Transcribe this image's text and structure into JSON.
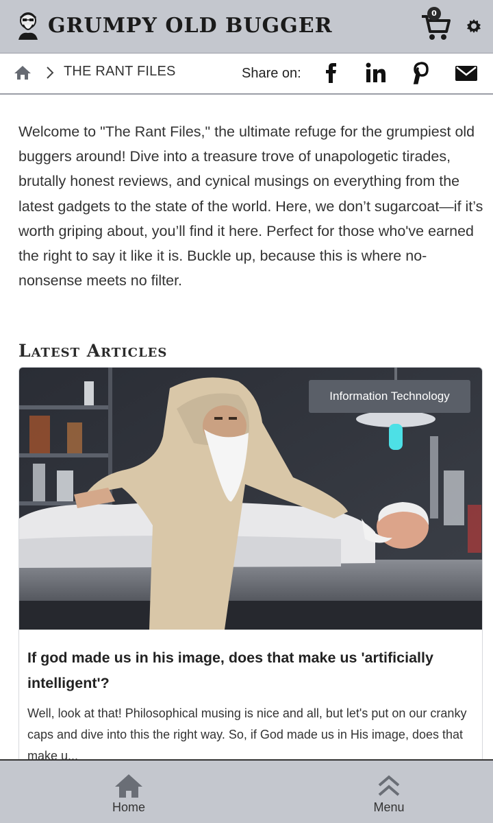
{
  "header": {
    "title": "GRUMPY OLD BUGGER",
    "logo_icon": "grumpy-old-man-face-icon",
    "cart_icon": "shopping-cart-icon",
    "cart_count": "0",
    "settings_icon": "gear-icon"
  },
  "breadcrumb": {
    "home_icon": "home-icon",
    "separator_icon": "chevron-right-icon",
    "current": "THE RANT FILES"
  },
  "share": {
    "label": "Share on:",
    "icons": [
      "facebook-icon",
      "linkedin-icon",
      "pinterest-icon",
      "email-icon"
    ]
  },
  "intro": {
    "text": "Welcome to \"The Rant Files,\" the ultimate refuge for the grumpiest old buggers around! Dive into a treasure trove of unapologetic tirades, brutally honest reviews, and cynical musings on everything from the latest gadgets to the state of the world. Here, we don’t sugarcoat—if it’s worth griping about, you’ll find it here. Perfect for those who've earned the right to say it like it is. Buckle up, because this is where no-nonsense meets no filter."
  },
  "latest": {
    "heading": "Latest Articles",
    "articles": [
      {
        "category": "Information Technology",
        "title": "If god made us in his image, does that make us 'artificially intelligent'?",
        "excerpt": "Well, look at that! Philosophical musing is nice and all, but let's put on our cranky caps and dive into this the right way. So, if God made us in His image, does that make u..."
      }
    ]
  },
  "bottom_nav": {
    "items": [
      {
        "label": "Home",
        "icon": "home-icon"
      },
      {
        "label": "Menu",
        "icon": "double-chevron-up-icon"
      }
    ]
  },
  "colors": {
    "header_bg": "#c4c7ce",
    "badge_bg": "#5a5f68",
    "text": "#333333"
  }
}
